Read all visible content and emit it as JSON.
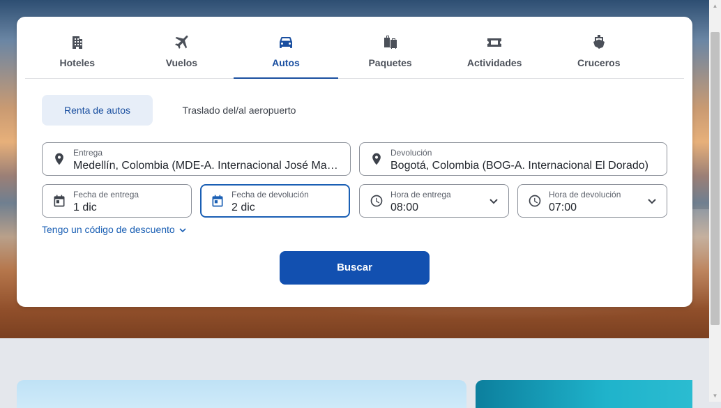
{
  "tabs": [
    {
      "label": "Hoteles",
      "icon": "hotel-icon"
    },
    {
      "label": "Vuelos",
      "icon": "plane-icon"
    },
    {
      "label": "Autos",
      "icon": "car-icon",
      "active": true
    },
    {
      "label": "Paquetes",
      "icon": "luggage-icon"
    },
    {
      "label": "Actividades",
      "icon": "ticket-icon"
    },
    {
      "label": "Cruceros",
      "icon": "ship-icon"
    }
  ],
  "subtabs": {
    "car_rental": "Renta de autos",
    "airport_transfer": "Traslado del/al aeropuerto"
  },
  "form": {
    "pickup": {
      "label": "Entrega",
      "value": "Medellín, Colombia (MDE-A. Internacional José María Córdova)"
    },
    "dropoff": {
      "label": "Devolución",
      "value": "Bogotá, Colombia (BOG-A. Internacional El Dorado)"
    },
    "pickup_date": {
      "label": "Fecha de entrega",
      "value": "1 dic"
    },
    "return_date": {
      "label": "Fecha de devolución",
      "value": "2 dic"
    },
    "pickup_time": {
      "label": "Hora de entrega",
      "value": "08:00"
    },
    "return_time": {
      "label": "Hora de devolución",
      "value": "07:00"
    }
  },
  "discount_link": "Tengo un código de descuento",
  "search_button": "Buscar",
  "colors": {
    "primary": "#1250b0",
    "accent_text": "#1a4fa0"
  }
}
